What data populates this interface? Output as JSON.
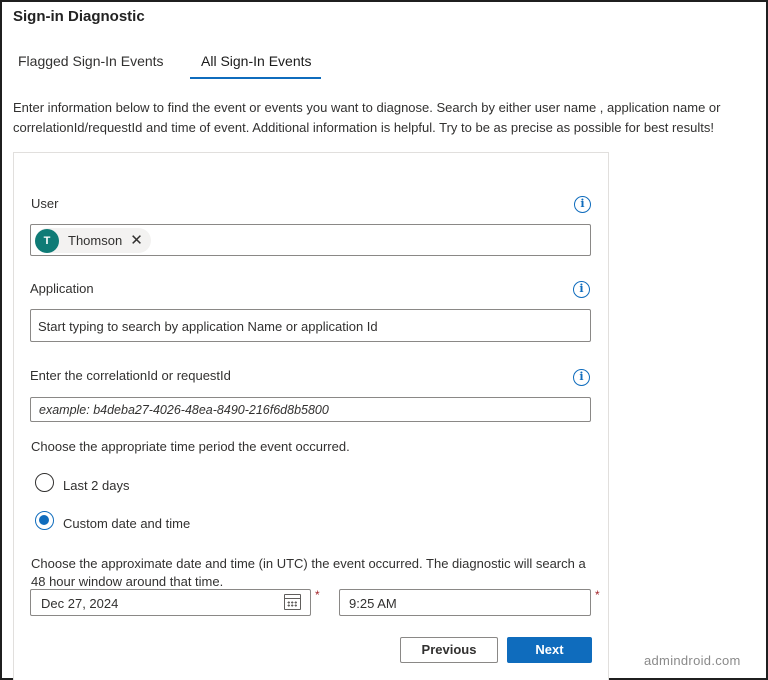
{
  "title": "Sign-in Diagnostic",
  "tabs": [
    {
      "label": "Flagged Sign-In Events",
      "active": false
    },
    {
      "label": "All Sign-In Events",
      "active": true
    }
  ],
  "intro": "Enter information below to find the event or events you want to diagnose. Search by either user name , application name or correlationId/requestId and time of event. Additional information is helpful. Try to be as precise as possible for best results!",
  "user": {
    "label": "User",
    "chip": {
      "initial": "T",
      "name": "Thomson",
      "remove_glyph": "✕"
    }
  },
  "application": {
    "label": "Application",
    "placeholder": "Start typing to search by application Name or application Id"
  },
  "correlation": {
    "label": "Enter the correlationId or requestId",
    "placeholder": "example: b4deba27-4026-48ea-8490-216f6d8b5800"
  },
  "time_period": {
    "label": "Choose the appropriate time period the event occurred.",
    "options": [
      {
        "label": "Last 2 days",
        "selected": false
      },
      {
        "label": "Custom date and time",
        "selected": true
      }
    ]
  },
  "approximate": {
    "label": "Choose the approximate date and time (in UTC) the event occurred. The diagnostic will search a 48 hour window around that time.",
    "date": "Dec 27, 2024",
    "time": "9:25 AM",
    "required_mark": "*"
  },
  "buttons": {
    "previous": "Previous",
    "next": "Next"
  },
  "watermark": "admindroid.com",
  "icons": {
    "info": "info-icon",
    "calendar": "calendar-icon",
    "close": "close-icon"
  },
  "colors": {
    "accent": "#0f6cbd",
    "avatar": "#0f7b76",
    "required": "#a4262c"
  }
}
